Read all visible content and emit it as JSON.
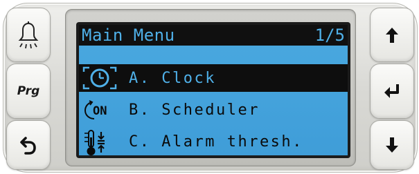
{
  "controller": {
    "left_buttons": [
      {
        "id": "alarm",
        "icon": "bell-icon"
      },
      {
        "id": "prg",
        "label": "Prg"
      },
      {
        "id": "esc",
        "icon": "back-arrow-icon"
      }
    ],
    "right_buttons": [
      {
        "id": "up",
        "icon": "arrow-up-icon"
      },
      {
        "id": "enter",
        "icon": "enter-icon"
      },
      {
        "id": "down",
        "icon": "arrow-down-icon"
      }
    ]
  },
  "screen": {
    "title": "Main Menu",
    "page": "1/5",
    "background_color": "#45a4dc",
    "items": [
      {
        "label": "A. Clock",
        "icon": "clock-icon",
        "selected": true
      },
      {
        "label": "B. Scheduler",
        "icon": "scheduler-on-icon",
        "icon_text": "ON",
        "selected": false
      },
      {
        "label": "C. Alarm thresh.",
        "icon": "thermometer-icon",
        "selected": false
      }
    ]
  }
}
